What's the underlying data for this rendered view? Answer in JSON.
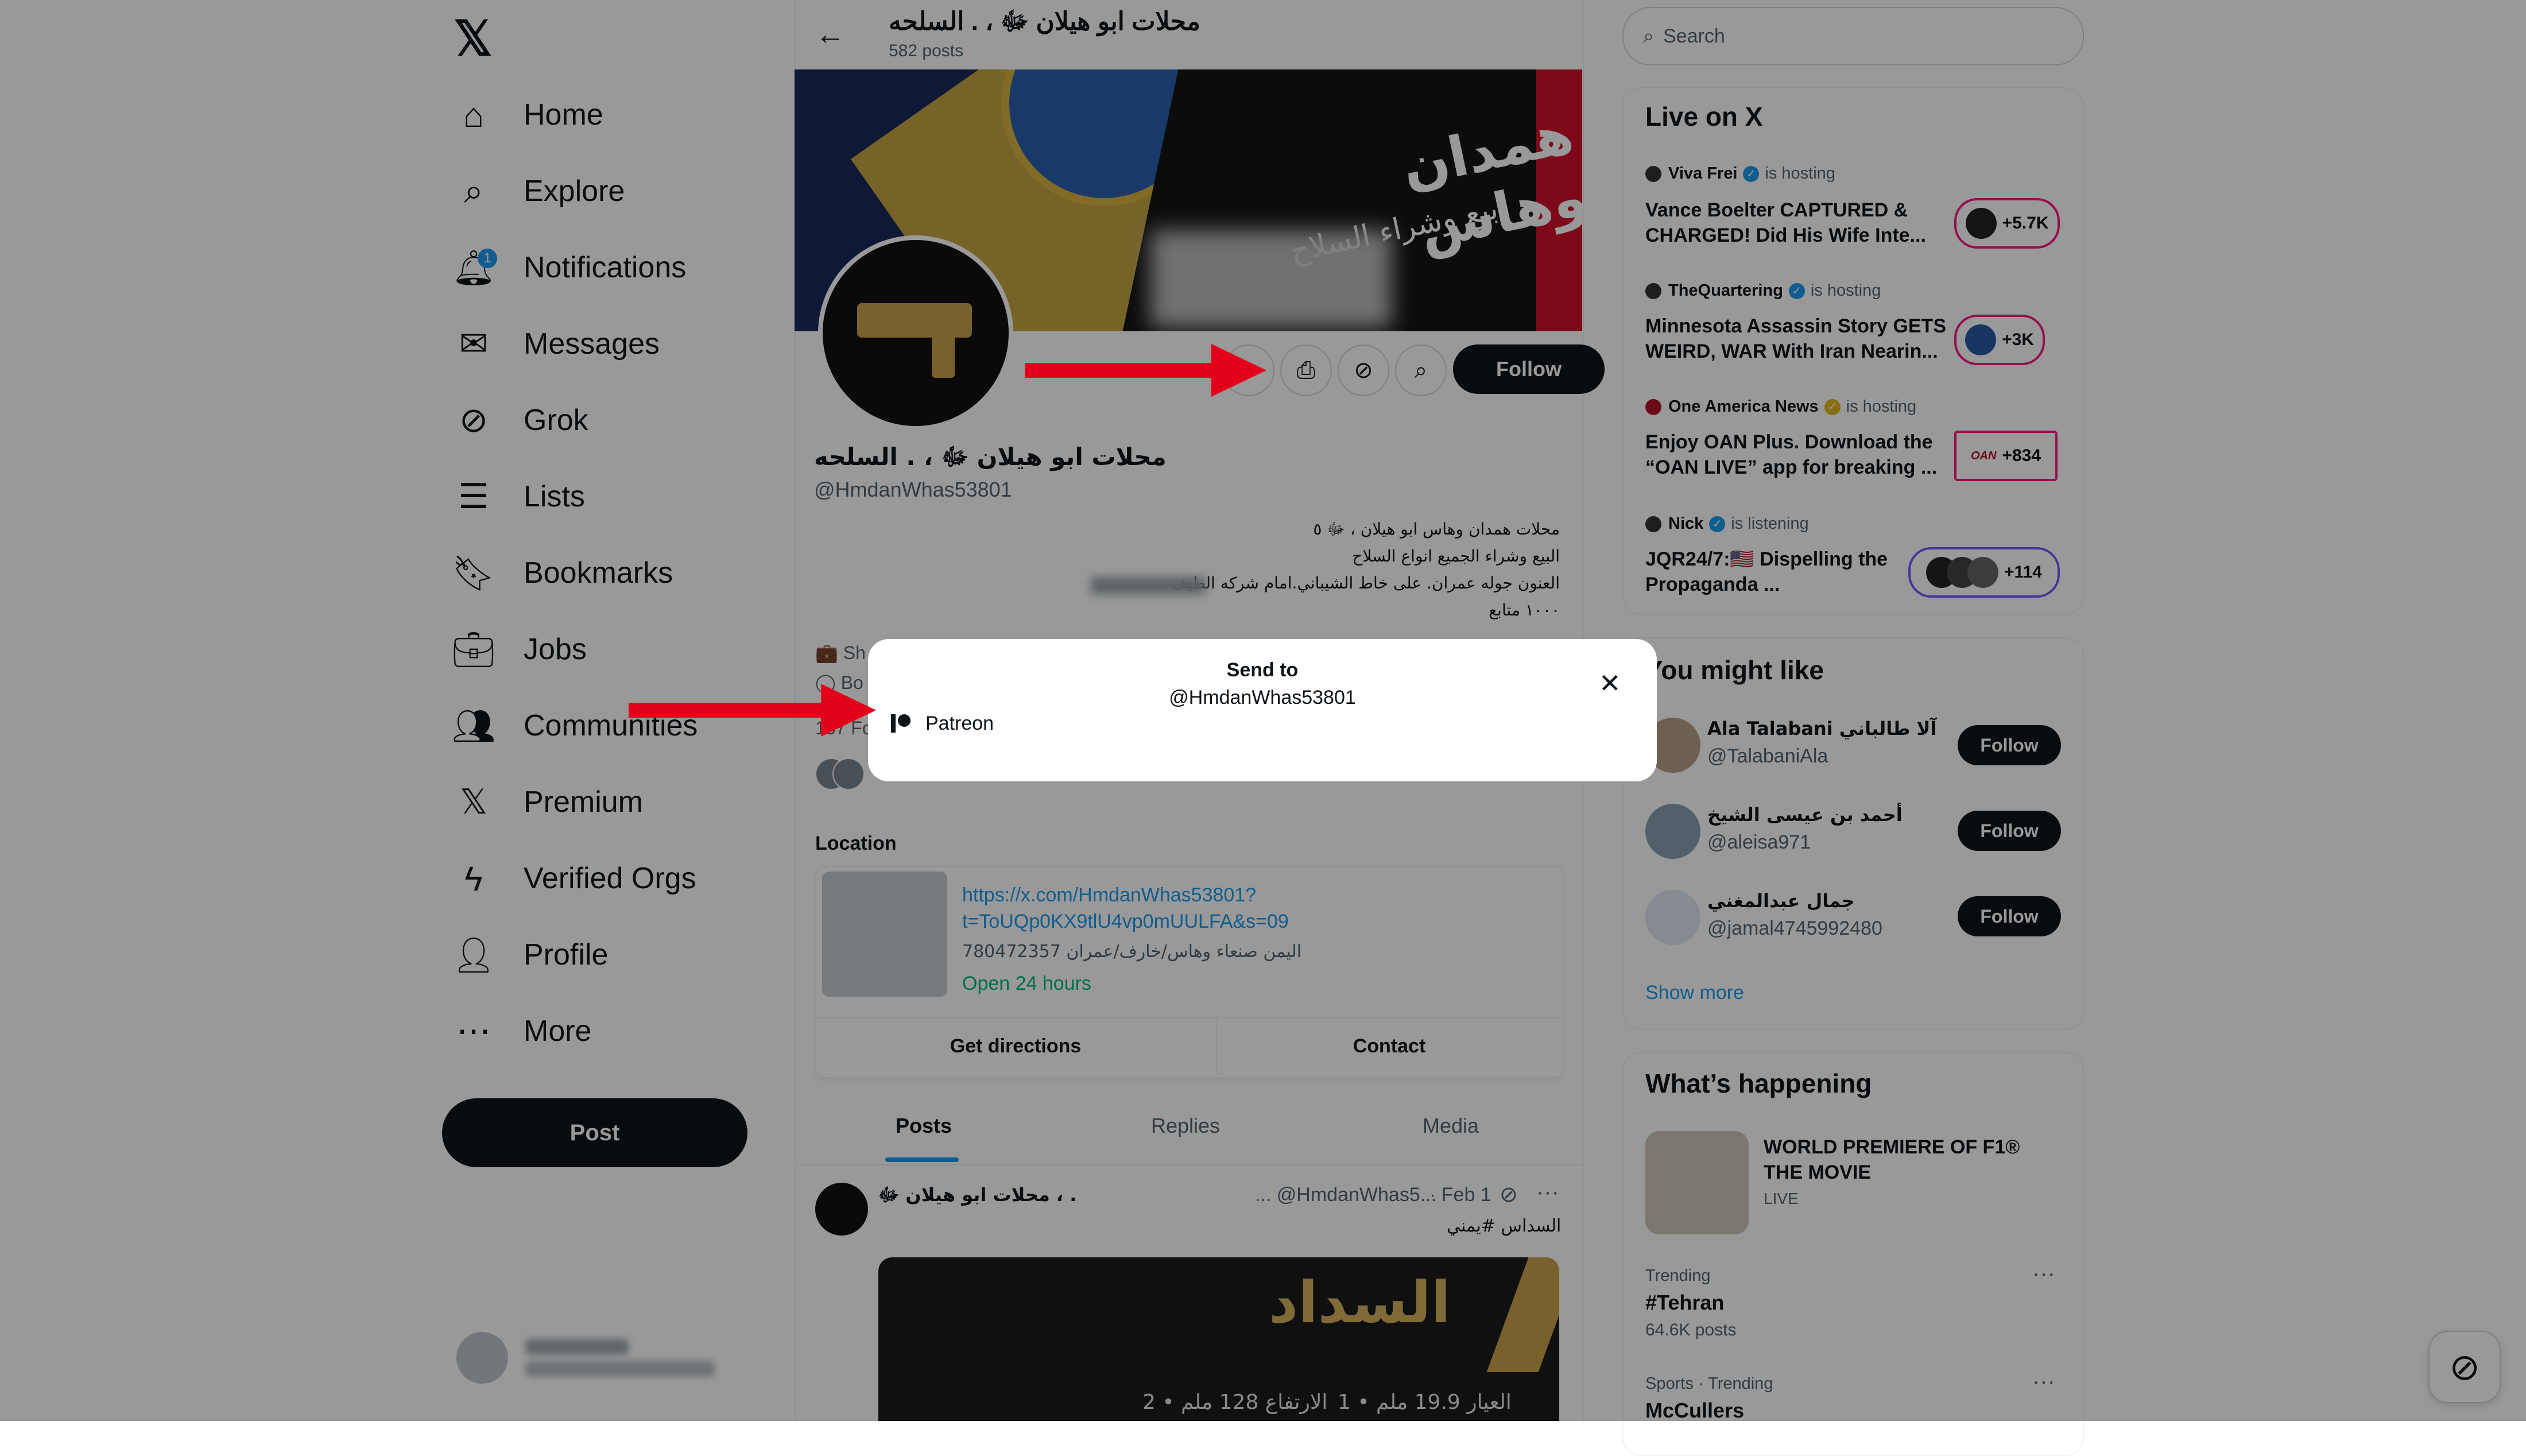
{
  "nav": {
    "logo": "𝕏",
    "items": [
      {
        "label": "Home",
        "icon": "home-icon",
        "glyph": "⌂"
      },
      {
        "label": "Explore",
        "icon": "search-icon",
        "glyph": "⌕"
      },
      {
        "label": "Notifications",
        "icon": "bell-icon",
        "glyph": "🔔︎",
        "badge": "1"
      },
      {
        "label": "Messages",
        "icon": "envelope-icon",
        "glyph": "✉"
      },
      {
        "label": "Grok",
        "icon": "grok-icon",
        "glyph": "⊘"
      },
      {
        "label": "Lists",
        "icon": "list-icon",
        "glyph": "☰"
      },
      {
        "label": "Bookmarks",
        "icon": "bookmark-icon",
        "glyph": "🔖︎"
      },
      {
        "label": "Jobs",
        "icon": "briefcase-icon",
        "glyph": "💼︎"
      },
      {
        "label": "Communities",
        "icon": "people-icon",
        "glyph": "👥︎"
      },
      {
        "label": "Premium",
        "icon": "x-premium-icon",
        "glyph": "𝕏"
      },
      {
        "label": "Verified Orgs",
        "icon": "lightning-icon",
        "glyph": "ϟ"
      },
      {
        "label": "Profile",
        "icon": "person-icon",
        "glyph": "👤︎"
      },
      {
        "label": "More",
        "icon": "more-circle-icon",
        "glyph": "⋯"
      }
    ],
    "post_button": "Post"
  },
  "header": {
    "back_glyph": "←",
    "name": "محلات ابو هيلان ﷻ          ،               .          السلحه",
    "posts": "582 posts"
  },
  "banner": {
    "title": "همدان وهاس",
    "subtitle": "بيع وشراء السلاح"
  },
  "profile": {
    "name": "محلات ابو هيلان ﷻ          ،               .          السلحه",
    "handle": "@HmdanWhas53801",
    "follow_label": "Follow",
    "action_icons": [
      "⋯",
      "⎙",
      "⊘",
      "⌕"
    ],
    "bio": [
      "محلات همدان وهاس ابو هيلان          ،          ﷻ          ٥",
      "البيع وشراء الجميع انواع السلاح",
      "العنون جوله عمران. على خاط الشيباني.امام شركه الطيف",
      "١٠٠٠ متابع"
    ],
    "meta1": "💼 Sh",
    "meta2": "◯ Bo",
    "followers": "167 Fo"
  },
  "location": {
    "title": "Location",
    "link_line1": "https://x.com/HmdanWhas53801?",
    "link_line2": "t=ToUQp0KX9tlU4vp0mUULFA&s=09",
    "address": "780472357 اليمن صنعاء وهاس/خارف/عمران",
    "hours": "Open 24 hours",
    "get_directions": "Get directions",
    "contact": "Contact"
  },
  "tabs": [
    "Posts",
    "Replies",
    "Media"
  ],
  "post": {
    "name": "محلات ابو هيلان ﷻ          ،               .",
    "handle": "... @HmdanWhas5...",
    "date": "· Feb 1",
    "text": "السداس #يمني",
    "more": "···",
    "media_title": "السداد",
    "media_sub1": "2 • الارتفاع 128 ملم",
    "media_sub2": "1 • العيار 19.9 ملم"
  },
  "search": {
    "placeholder": "Search",
    "glyph": "⌕"
  },
  "live": {
    "title": "Live on X",
    "items": [
      {
        "host": "Viva Frei",
        "status": "is hosting",
        "title": "Vance Boelter CAPTURED & CHARGED! Did His Wife Inte...",
        "count": "+5.7K",
        "verified": "blue"
      },
      {
        "host": "TheQuartering",
        "status": "is hosting",
        "title": "Minnesota Assassin Story GETS WEIRD, WAR With Iran Nearin...",
        "count": "+3K",
        "verified": "blue"
      },
      {
        "host": "One America News",
        "status": "is hosting",
        "title": "Enjoy OAN Plus. Download the “OAN LIVE” app for breaking ...",
        "count": "+834",
        "verified": "gold",
        "badge": "OAN"
      },
      {
        "host": "Nick",
        "status": "is listening",
        "title": "JQR24/7:🇺🇸 Dispelling the Propaganda ...",
        "count": "+114",
        "verified": "blue"
      }
    ]
  },
  "like": {
    "title": "You might like",
    "users": [
      {
        "name": "Ala Talabani آلا طالباني",
        "handle": "@TalabaniAla",
        "follow": "Follow"
      },
      {
        "name": "أحمد بن عيسى الشيخ",
        "handle": "@aleisa971",
        "follow": "Follow"
      },
      {
        "name": "جمال عبدالمغني",
        "handle": "@jamal4745992480",
        "follow": "Follow"
      }
    ],
    "show_more": "Show more"
  },
  "happening": {
    "title": "What’s happening",
    "feature_title": "WORLD PREMIERE OF F1® THE MOVIE",
    "feature_status": "LIVE",
    "trends": [
      {
        "category": "Trending",
        "name": "#Tehran",
        "count": "64.6K posts"
      },
      {
        "category": "Sports · Trending",
        "name": "McCullers",
        "count": ""
      }
    ],
    "more": "···"
  },
  "grok_float_glyph": "⊘",
  "modal": {
    "title": "Send to",
    "handle": "@HmdanWhas53801",
    "close": "✕",
    "option": "Patreon"
  },
  "colors": {
    "accent": "#1d9bf0",
    "text": "#0f1419",
    "muted": "#536471",
    "live_pink": "#f91880",
    "arrow_red": "#e3001b",
    "open_green": "#00ba7c"
  }
}
